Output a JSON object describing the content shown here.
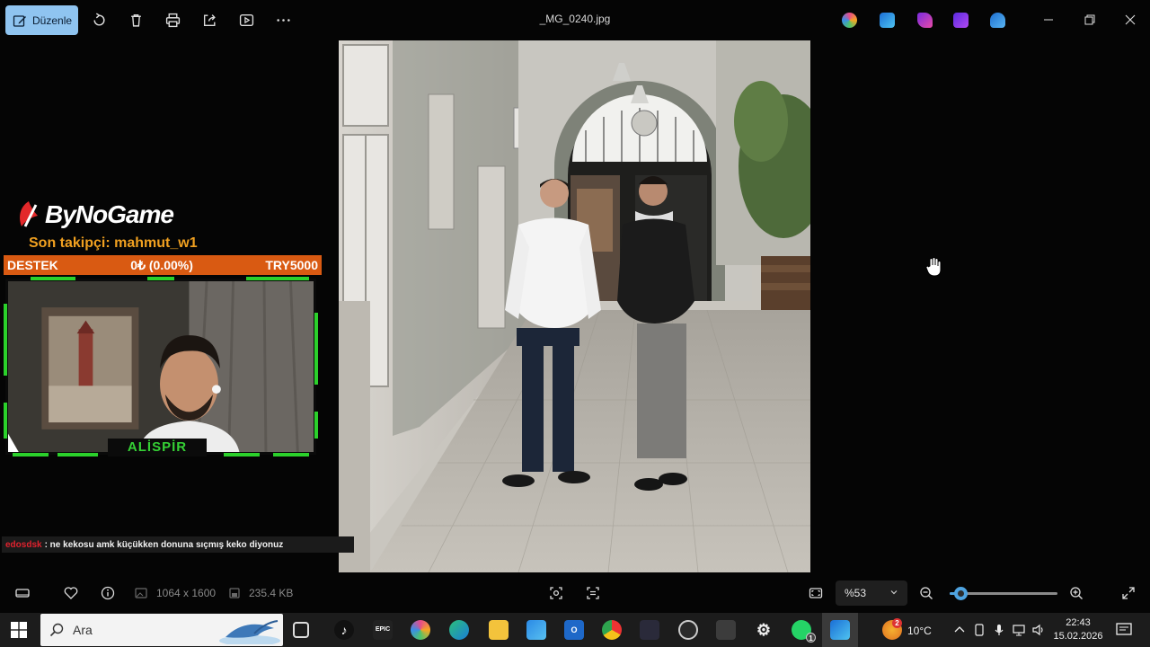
{
  "toolbar": {
    "edit_label": "Düzenle",
    "file_title": "_MG_0240.jpg"
  },
  "overlay": {
    "brand": "ByNoGame",
    "follower_text": "Son takipçi: mahmut_w1",
    "support": {
      "label": "DESTEK",
      "amount": "0₺ (0.00%)",
      "goal": "TRY5000"
    },
    "cam_name": "ALİSPİR"
  },
  "chat": {
    "user": "edosdsk",
    "message": ": ne kekosu amk küçükken donuna sıçmış keko diyonuz"
  },
  "infobar": {
    "dimensions": "1064 x 1600",
    "file_size": "235.4 KB",
    "zoom_label": "%53",
    "zoom_level": 0.1
  },
  "taskbar": {
    "search_placeholder": "Ara",
    "weather": "10°C",
    "weather_badge": "2",
    "whatsapp_badge": "1",
    "time": "22:43",
    "date": "15.02.2026"
  },
  "colors": {
    "accent": "#4ea3e0",
    "edit_button": "#8fc4f0",
    "support_bar": "#d95a12",
    "follower": "#f0a020",
    "cam_name": "#35d135",
    "chat_user": "#e0222e"
  }
}
